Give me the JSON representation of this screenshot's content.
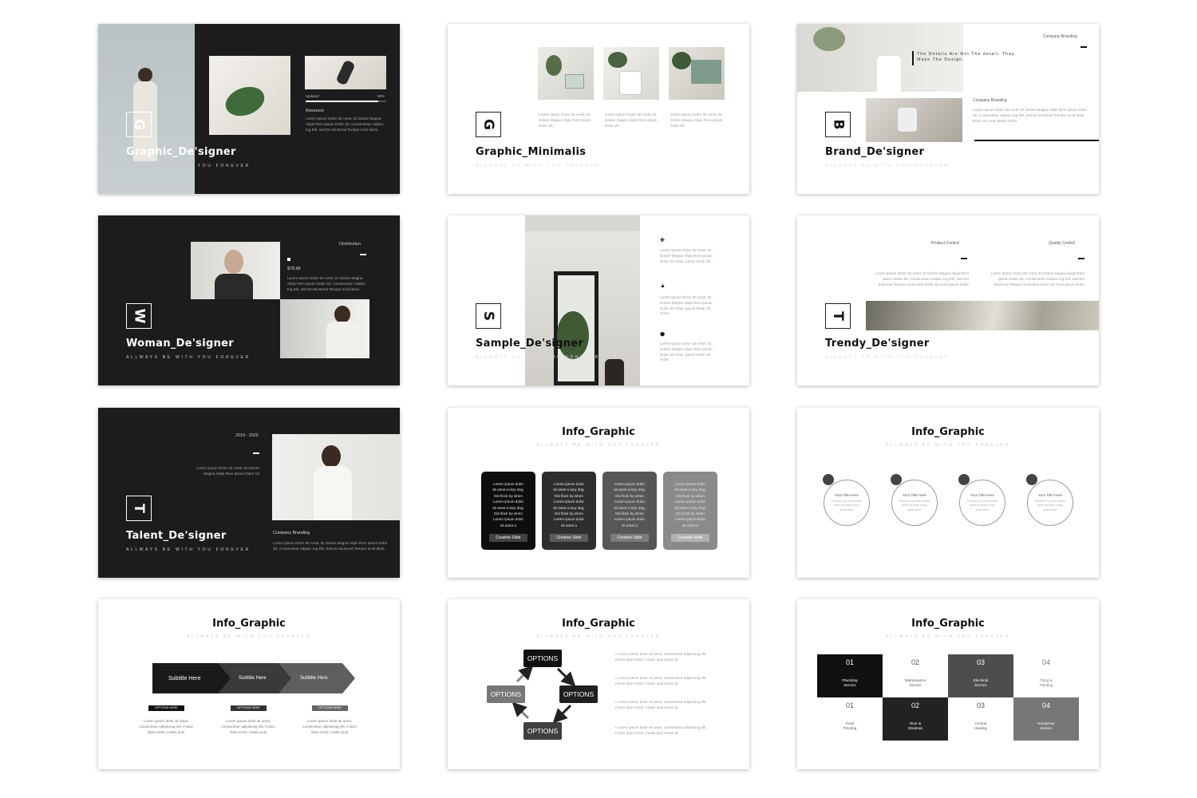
{
  "colors": {
    "dark_bg": "#1c1c1c",
    "light_bg": "#ffffff",
    "accent": "#111111"
  },
  "slides": {
    "s1": {
      "badge": "G",
      "title": "Graphic_De'signer",
      "subtitle": "ALLWAYS BE WITH YOU FOREVER",
      "updated_label": "Updated",
      "progress_value": "90%",
      "progress_fraction": 0.9,
      "resource_label": "Resource",
      "body": "Lorem Ipsum Dolor Sit Amet, Et Dolore Magna Aliqis Rem Ipsum Dolor Sit, Consectetur Adipisc Ing Elit, Sed Do Eiusmod Tempor Incid idunt."
    },
    "s2": {
      "badge": "G",
      "title": "Graphic_Minimalis",
      "subtitle": "ALLWAYS BE WITH YOU FOREVER",
      "col1": "Lorem Ipsum Dolor Sit Amet, Et Dolore Magna Aliqis Rem Ipsum Dolor Sit",
      "col2": "Lorem Ipsum Dolor Sit Amet, Et Dolore Magna Aliqis Rem Ipsum Dolor Sit",
      "col3": "Lorem Ipsum Dolor Sit Amet, Et Dolore Magna Aliqis Rem Ipsum Dolor Sit"
    },
    "s3": {
      "badge": "B",
      "title": "Brand_De'signer",
      "subtitle": "ALLWAYS BE WITH YOU FOREVER",
      "top_label": "Company Branding",
      "quote": "The Details Are Not The detail, Thay Make The Design.",
      "mid_label": "Company Branding",
      "body": "Lorem Ipsum Dolor Sit Amet, Et Dolore Magna Aliqis Rem Ipsum Dolor Sit, Consectetur Adipisc Ing Elit, Sed Do Eiusmod Tempor Incid idunt Dolor Sit Amet Ipsum Dolor"
    },
    "s4": {
      "badge": "W",
      "title": "Woman_De'signer",
      "subtitle": "ALLWAYS BE WITH YOU FOREVER",
      "label": "Distribution",
      "price": "$78,99",
      "body": "Lorem Ipsum Dolor Sit Amet, Et Dolore Magna Aliqis Rem Ipsum Dolor Sit, Consectetur Adipisc Ing Elit, Sed Do Eiusmod Tempor Incid idunt."
    },
    "s5": {
      "badge": "S",
      "title": "Sample_De'signer",
      "subtitle": "ALLWAYS BE WITH YOU FOREVER",
      "item1": "Lorem Ipsum Dolor Sit Amet, Et Dolore Magna Aliqis Rem Ipsum Dolor Sit Amet, Ipsum Dolor Sit",
      "item2": "Lorem Ipsum Dolor Sit Amet, Et Dolore Magna Aliqis Rem Ipsum Dolor Sit Amet, Ipsum Dolor Sit Amet.",
      "item3": "Lorem Ipsum Dolor Sit Amet, Et Dolore Magna Aliqis Rem Ipsum Dolor Sit Amet, Ipsum Dolor Sit Amet."
    },
    "s6": {
      "badge": "T",
      "title": "Trendy_De'signer",
      "subtitle": "ALLWAYS BE WITH YOU FOREVER",
      "label1": "Product Control",
      "label2": "Quality Control",
      "body1": "Lorem Ipsum Dolor Sit Amet, Et Dolore Magna Aliqis Rem Ipsum Dolor Sit, Consectetur Adipisc Ing Elit, Sed Do Eiusmod Tempor Incid idunt Dolor Sit Amet Ipsum Dolor",
      "body2": "Lorem Ipsum Dolor Sit Amet, Et Dolore Magna Aliqis Rem Ipsum Dolor Sit, Consectetur Adipisc Ing Elit, Sed Do Eiusmod Tempor Incid idunt Dolor Sit Amet Ipsum Dolor"
    },
    "s7": {
      "badge": "T",
      "title": "Talent_De'signer",
      "subtitle": "ALLWAYS BE WITH YOU FOREVER",
      "years": "2019 - 2020",
      "body_top": "Lorem Ipsum Dolor Sit Amet, Et Dolore Magna Aliqis Rem Ipsum Dolor Sit",
      "label": "Company Branding",
      "body_bottom": "Lorem Ipsum Dolor Sit Amet, Et Dolore Magna Aliqis Rem Ipsum Dolor Sit, Consectetur Adipisc Ing Elit, Sed Do Eiusmod Tempor Incid idunt."
    },
    "s8": {
      "title": "Info_Graphic",
      "subtitle": "ALLWAYS BE WITH YOU FOREVER",
      "cards": [
        {
          "text": "Lorem ipsum dolor\nsit amet a lazy dog.\nDis flock by when\nLorem ipsum dolor\nsit amet a lazy dog.\nDis flock by when\nLorem ipsum dolor\nsit amet a",
          "button": "Creative Slide",
          "bg": "#0e0e0e"
        },
        {
          "text": "Lorem ipsum dolor\nsit amet a lazy dog.\nDis flock by when\nLorem ipsum dolor\nsit amet a lazy dog.\nDis flock by when\nLorem ipsum dolor\nsit amet a",
          "button": "Creative Slide",
          "bg": "#2e2e2e"
        },
        {
          "text": "Lorem ipsum dolor\nsit amet a lazy dog.\nDis flock by when\nLorem ipsum dolor\nsit amet a lazy dog.\nDis flock by when\nLorem ipsum dolor\nsit amet a",
          "button": "Creative Slide",
          "bg": "#575757"
        },
        {
          "text": "Lorem ipsum dolor\nsit amet a lazy dog.\nDis flock by when\nLorem ipsum dolor\nsit amet a lazy dog.\nDis flock by when\nLorem ipsum dolor\nsit amet a",
          "button": "Creative Slide",
          "bg": "#8a8a8a"
        }
      ]
    },
    "s9": {
      "title": "Info_Graphic",
      "subtitle": "ALLWAYS BE WITH YOU FOREVER",
      "circles": [
        {
          "title": "Your Title Here",
          "text": "Dis flock by when lorem\ndolor sit amet a lazy\namet dolor"
        },
        {
          "title": "Your Title Here",
          "text": "Dis flock by when lorem\ndolor sit amet a lazy\namet dolor"
        },
        {
          "title": "Your Title Here",
          "text": "Dis flock by when lorem\ndolor sit amet a lazy\namet dolor"
        },
        {
          "title": "Your Title Here",
          "text": "Dis flock by when lorem\ndolor sit amet a lazy\namet dolor"
        }
      ]
    },
    "s10": {
      "title": "Info_Graphic",
      "subtitle": "ALLWAYS BE WITH YOU FOREVER",
      "arrows": [
        "Subtitle Here",
        "Subtitle Here",
        "Subtitle Here"
      ],
      "tags": [
        "OPTIONS HERE",
        "OPTIONS HERE",
        "OPTIONS HERE"
      ],
      "texts": [
        "Lorem ipsum dolor sit amet,\nconsectetur adipiscing elit. Fusce\ndiam tortor, mattis quis",
        "Lorem ipsum dolor sit amet,\nconsectetur adipiscing elit. Fusce\ndiam tortor, mattis quis",
        "Lorem ipsum dolor sit amet,\nconsectetur adipiscing elit. Fusce\ndiam tortor, mattis quis"
      ]
    },
    "s11": {
      "title": "Info_Graphic",
      "subtitle": "ALLWAYS BE WITH YOU FOREVER",
      "options": [
        "OPTIONS",
        "OPTIONS",
        "OPTIONS",
        "OPTIONS"
      ],
      "bullets": [
        "Lorem ipsum dolor sit amet, consectetur adipiscing elit. Fusce diam tortor, mattis quis lectus at.",
        "Lorem ipsum dolor sit amet, consectetur adipiscing elit. Fusce diam tortor, mattis quis lectus at.",
        "Lorem ipsum dolor sit amet, consectetur adipiscing elit. Fusce diam tortor, mattis quis lectus at.",
        "Lorem ipsum dolor sit amet, consectetur adipiscing elit. Fusce diam tortor, mattis quis lectus at."
      ]
    },
    "s12": {
      "title": "Info_Graphic",
      "subtitle": "ALLWAYS BE WITH YOU FOREVER",
      "cells": [
        {
          "num": "01",
          "label": "Plumbing\nService",
          "bg": "#111111",
          "fg": "#ffffff"
        },
        {
          "num": "02",
          "label": "Maintenance\nService",
          "bg": "#ffffff",
          "fg": "#555555"
        },
        {
          "num": "03",
          "label": "Electrical\nService",
          "bg": "#4d4d4d",
          "fg": "#ffffff"
        },
        {
          "num": "04",
          "label": "Tiling &\nPainting",
          "bg": "#ffffff",
          "fg": "#777777"
        },
        {
          "num": "01",
          "label": "Food\nFlooring",
          "bg": "#ffffff",
          "fg": "#555555"
        },
        {
          "num": "02",
          "label": "Door &\nWindows",
          "bg": "#222222",
          "fg": "#ffffff"
        },
        {
          "num": "03",
          "label": "Central\nHeating",
          "bg": "#ffffff",
          "fg": "#555555"
        },
        {
          "num": "04",
          "label": "Handyman\nService",
          "bg": "#777777",
          "fg": "#ffffff"
        }
      ]
    }
  }
}
